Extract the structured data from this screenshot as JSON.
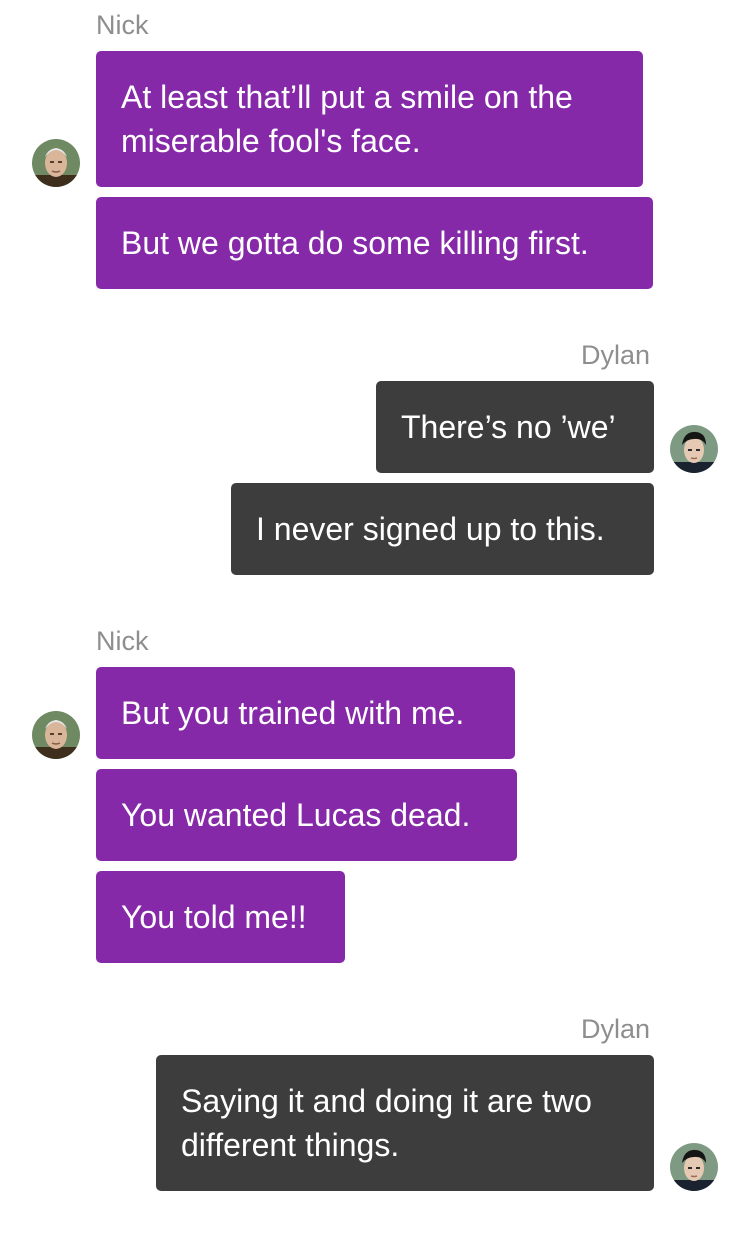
{
  "conversation": {
    "groups": [
      {
        "sender": "Nick",
        "messages": [
          "At least that’ll put a smile on the",
          "miserable fool's face.",
          "But we gotta do some killing first."
        ]
      },
      {
        "sender": "Dylan",
        "messages": [
          "There’s no ’we’",
          "I never signed up to this."
        ]
      },
      {
        "sender": "Nick",
        "messages": [
          "But you trained with me.",
          "You wanted Lucas dead.",
          "You told me!!"
        ]
      },
      {
        "sender": "Dylan",
        "messages": [
          "Saying it and doing it are two",
          "different things."
        ]
      }
    ]
  },
  "colors": {
    "nick_bubble": "#8529a8",
    "dylan_bubble": "#3d3d3d",
    "sender_name": "#8e8e8e",
    "bubble_text": "#ffffff"
  }
}
